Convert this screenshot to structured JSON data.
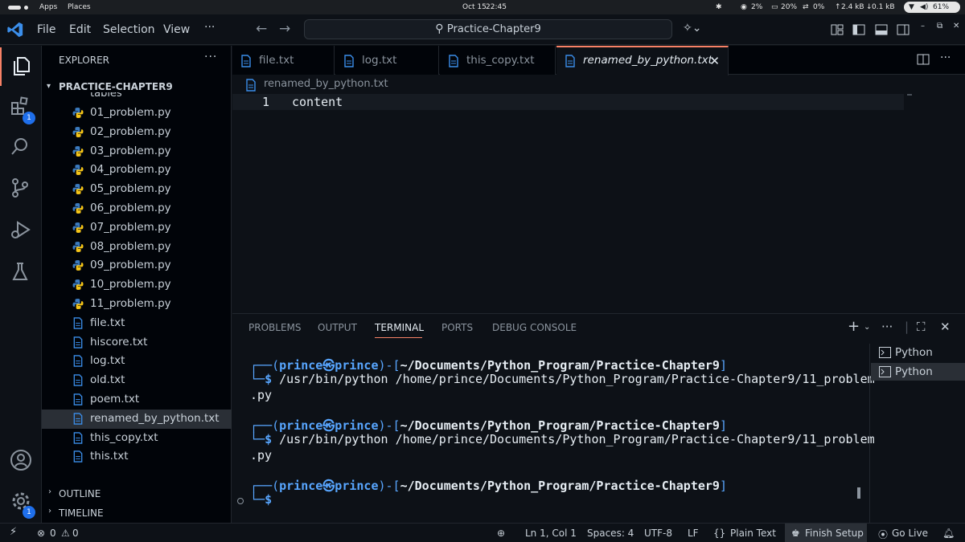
{
  "system_bar": {
    "apps_label": "Apps",
    "places_label": "Places",
    "date": "Oct 15",
    "time": "22:45",
    "cpu": "2%",
    "memory": "20%",
    "swap": "0%",
    "upload": "2.4 kB",
    "download": "0.1 kB",
    "battery": "61%"
  },
  "titlebar": {
    "menus": [
      "File",
      "Edit",
      "Selection",
      "View",
      "···"
    ],
    "command_center": "Practice-Chapter9"
  },
  "activity_bar": {
    "extensions_badge": "1",
    "settings_badge": "1"
  },
  "sidebar": {
    "title": "EXPLORER",
    "more": "···",
    "folder": "PRACTICE-CHAPTER9",
    "partial_folder": "tables",
    "files": [
      {
        "name": "01_problem.py",
        "type": "py"
      },
      {
        "name": "02_problem.py",
        "type": "py"
      },
      {
        "name": "03_problem.py",
        "type": "py"
      },
      {
        "name": "04_problem.py",
        "type": "py"
      },
      {
        "name": "05_problem.py",
        "type": "py"
      },
      {
        "name": "06_problem.py",
        "type": "py"
      },
      {
        "name": "07_problem.py",
        "type": "py"
      },
      {
        "name": "08_problem.py",
        "type": "py"
      },
      {
        "name": "09_problem.py",
        "type": "py"
      },
      {
        "name": "10_problem.py",
        "type": "py"
      },
      {
        "name": "11_problem.py",
        "type": "py"
      },
      {
        "name": "file.txt",
        "type": "txt"
      },
      {
        "name": "hiscore.txt",
        "type": "txt"
      },
      {
        "name": "log.txt",
        "type": "txt"
      },
      {
        "name": "old.txt",
        "type": "txt"
      },
      {
        "name": "poem.txt",
        "type": "txt"
      },
      {
        "name": "renamed_by_python.txt",
        "type": "txt",
        "selected": true
      },
      {
        "name": "this_copy.txt",
        "type": "txt"
      },
      {
        "name": "this.txt",
        "type": "txt"
      }
    ],
    "outline": "OUTLINE",
    "timeline": "TIMELINE"
  },
  "tabs": [
    {
      "name": "file.txt"
    },
    {
      "name": "log.txt"
    },
    {
      "name": "this_copy.txt"
    },
    {
      "name": "renamed_by_python.txt",
      "active": true
    }
  ],
  "editor": {
    "breadcrumb": "renamed_by_python.txt",
    "line_number": "1",
    "line_content": "content"
  },
  "panel": {
    "tabs": [
      "PROBLEMS",
      "OUTPUT",
      "TERMINAL",
      "PORTS",
      "DEBUG CONSOLE"
    ],
    "active_tab": "TERMINAL",
    "terminals": [
      "Python",
      "Python"
    ],
    "prompt_user": "prince㉿prince",
    "prompt_dir": "~/Documents/Python_Program/Practice-Chapter9",
    "command_line1": "/usr/bin/python /home/prince/Documents/Python_Program/Practice-Chapter9/11_problem",
    "command_line2": ".py"
  },
  "statusbar": {
    "errors": "0",
    "warnings": "0",
    "position": "Ln 1, Col 1",
    "spaces": "Spaces: 4",
    "encoding": "UTF-8",
    "eol": "LF",
    "language": "Plain Text",
    "finish_setup": "Finish Setup",
    "go_live": "Go Live"
  }
}
